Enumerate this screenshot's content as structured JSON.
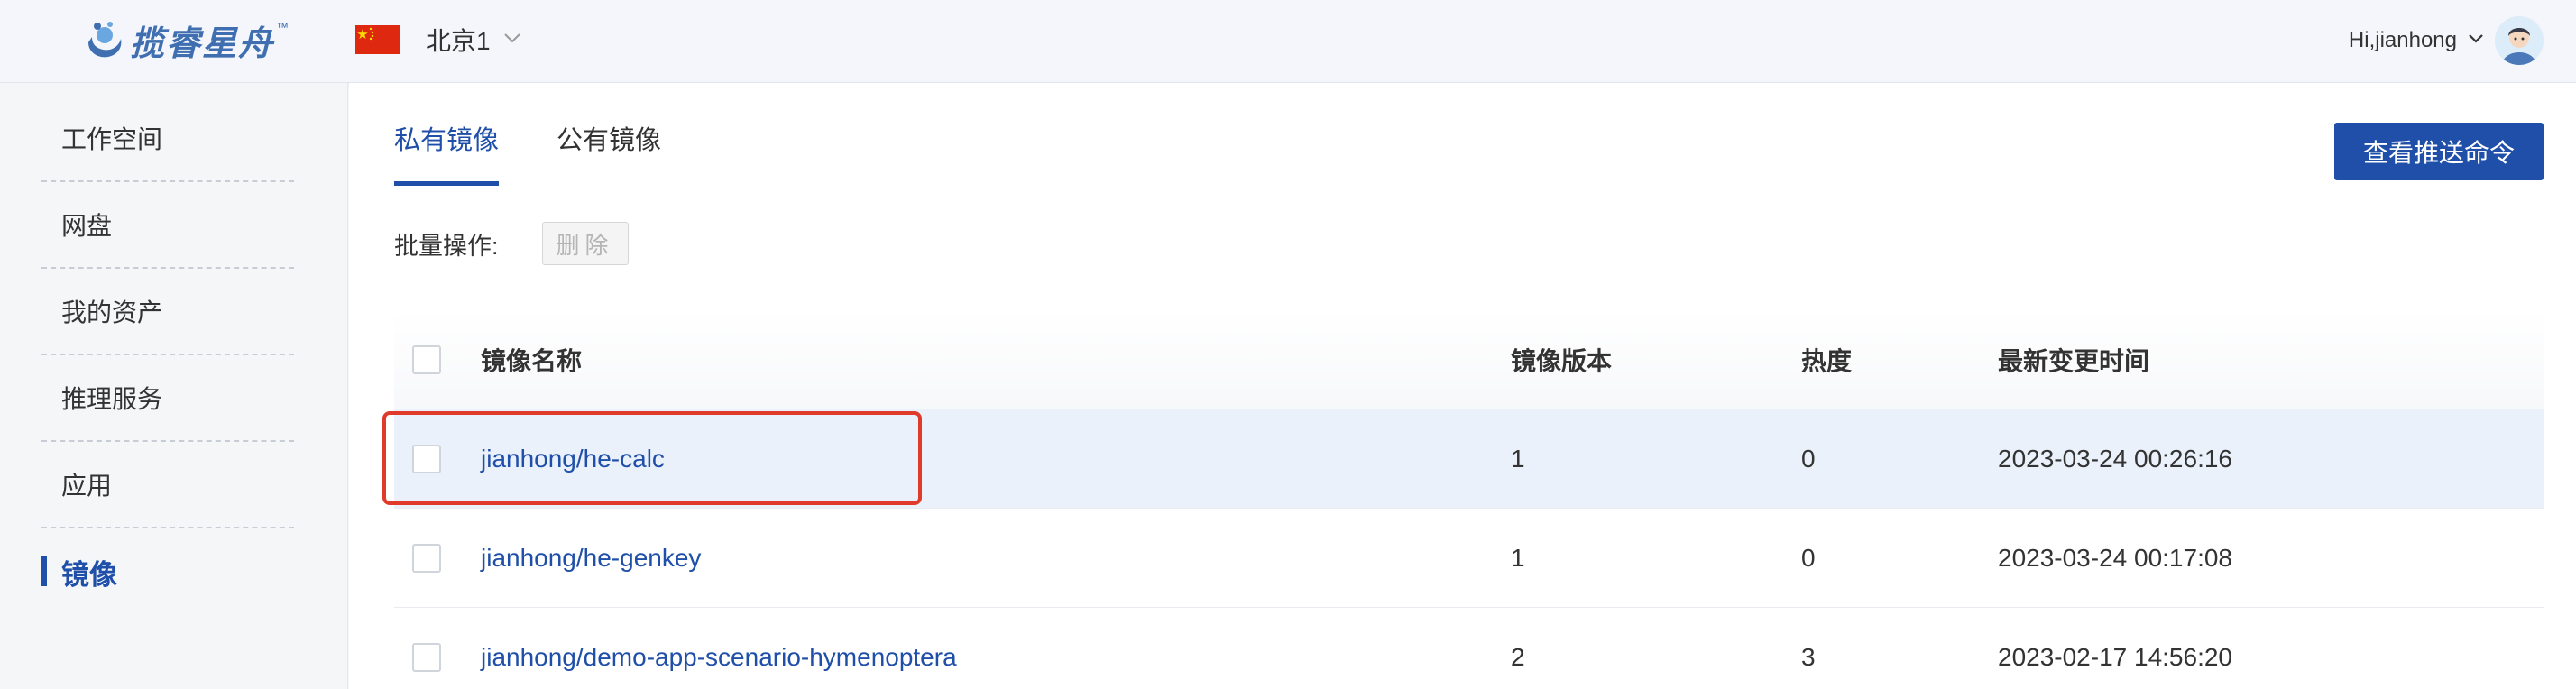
{
  "header": {
    "logo_text": "揽睿星舟",
    "logo_tm": "™",
    "region": {
      "label": "北京1",
      "flag_icon": "china-flag-icon"
    },
    "user": {
      "greeting": "Hi,jianhong"
    }
  },
  "sidebar": {
    "items": [
      {
        "label": "工作空间",
        "active": false
      },
      {
        "label": "网盘",
        "active": false
      },
      {
        "label": "我的资产",
        "active": false
      },
      {
        "label": "推理服务",
        "active": false
      },
      {
        "label": "应用",
        "active": false
      },
      {
        "label": "镜像",
        "active": true
      }
    ]
  },
  "main": {
    "tabs": [
      {
        "label": "私有镜像",
        "active": true
      },
      {
        "label": "公有镜像",
        "active": false
      }
    ],
    "view_push_command_label": "查看推送命令",
    "batch": {
      "label": "批量操作:",
      "delete_label": "删除"
    },
    "table": {
      "columns": [
        "镜像名称",
        "镜像版本",
        "热度",
        "最新变更时间"
      ],
      "rows": [
        {
          "name": "jianhong/he-calc",
          "version": "1",
          "heat": "0",
          "updated": "2023-03-24 00:26:16",
          "highlight": true
        },
        {
          "name": "jianhong/he-genkey",
          "version": "1",
          "heat": "0",
          "updated": "2023-03-24 00:17:08",
          "highlight": false
        },
        {
          "name": "jianhong/demo-app-scenario-hymenoptera",
          "version": "2",
          "heat": "3",
          "updated": "2023-02-17 14:56:20",
          "highlight": false
        }
      ]
    }
  },
  "colors": {
    "primary": "#1f4fa8",
    "callout": "#e03a2b",
    "row_highlight": "#eaf1fb"
  }
}
